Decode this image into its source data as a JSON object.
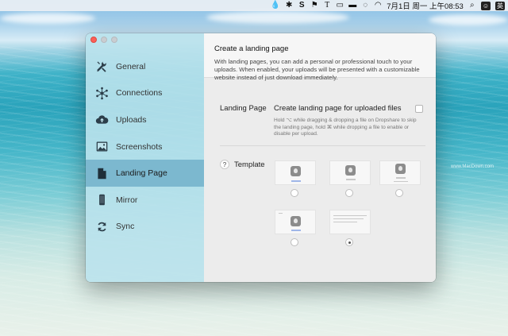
{
  "menubar": {
    "datetime": "7月1日 周一 上午08:53",
    "icons": [
      "drop-icon",
      "slack-icon",
      "s-icon",
      "flag-badge-icon",
      "text-icon",
      "video-icon",
      "display-icon",
      "wechat-icon",
      "wifi-icon",
      "user-icon",
      "input-method-icon"
    ]
  },
  "sidebar": {
    "items": [
      {
        "label": "General",
        "icon": "tools-icon"
      },
      {
        "label": "Connections",
        "icon": "network-icon"
      },
      {
        "label": "Uploads",
        "icon": "cloud-upload-icon"
      },
      {
        "label": "Screenshots",
        "icon": "picture-icon"
      },
      {
        "label": "Landing Page",
        "icon": "document-icon",
        "active": true
      },
      {
        "label": "Mirror",
        "icon": "phone-icon"
      },
      {
        "label": "Sync",
        "icon": "sync-icon"
      }
    ]
  },
  "header": {
    "title": "Create a landing page",
    "description": "With landing pages, you can add a personal or professional touch to your uploads. When enabled, your uploads will be presented with a customizable website instead of just download immediately."
  },
  "landing_page": {
    "label": "Landing Page",
    "checkbox_label": "Create landing page for uploaded files",
    "checked": false,
    "help_text": "Hold ⌥ while dragging & dropping a file on Dropshare to skip the landing page, hold ⌘ while dropping a file to enable or disable per upload."
  },
  "template": {
    "help_button": "?",
    "label": "Template",
    "selected_index": 4,
    "count": 5
  },
  "watermark": "www.MacDown.com",
  "colors": {
    "sidebar_active": "#7cb8cf",
    "close_button": "#fc5f57"
  }
}
